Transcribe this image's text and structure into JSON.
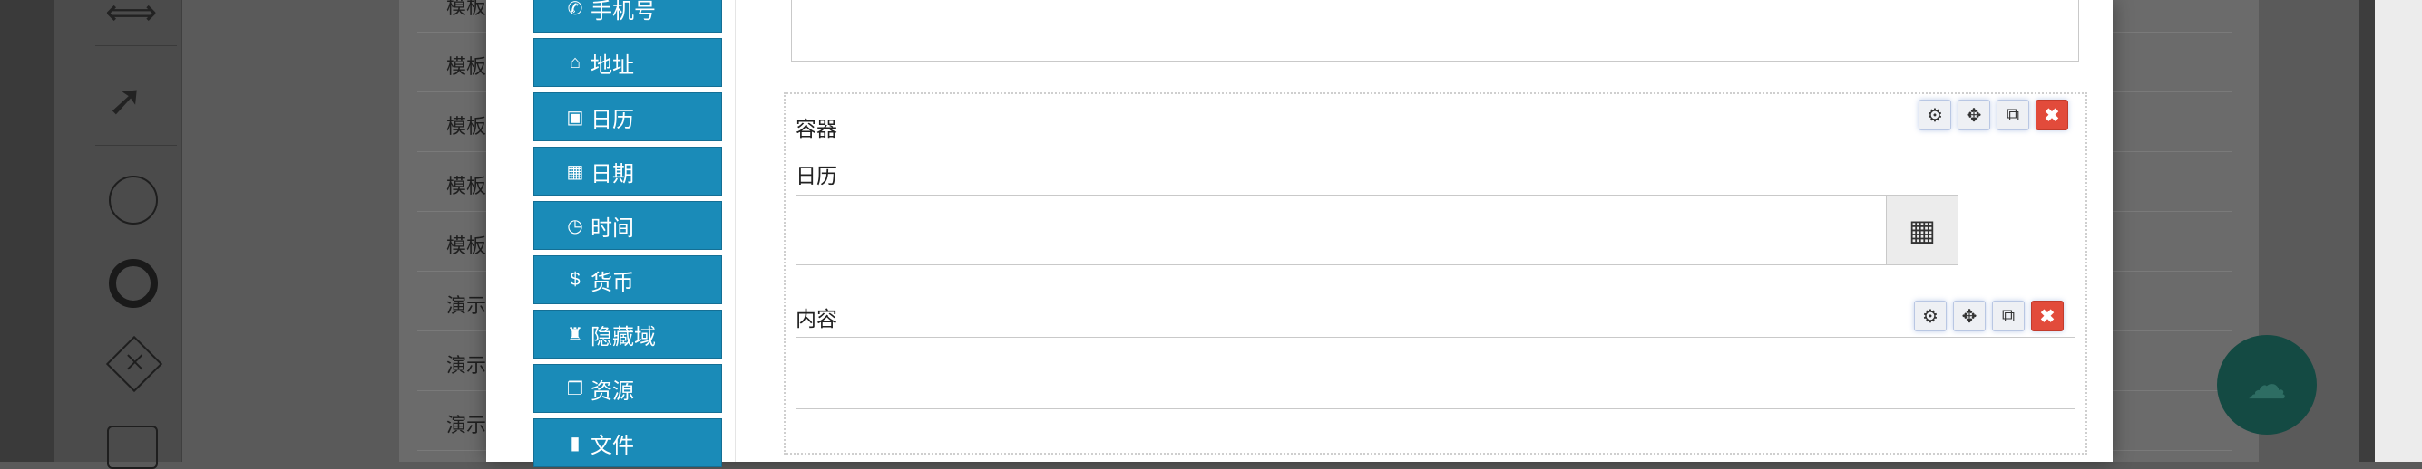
{
  "palette": {
    "icons": [
      "resize-horizontal-icon",
      "connector-arrow-icon",
      "start-event-icon",
      "end-event-icon",
      "gateway-icon",
      "user-task-icon"
    ]
  },
  "list": {
    "rows": [
      "模板",
      "模板",
      "模板",
      "模板",
      "模板",
      "演示",
      "演示",
      "演示"
    ]
  },
  "field_menu": [
    {
      "label": "手机号",
      "icon": "phone-icon",
      "glyph": "✆"
    },
    {
      "label": "地址",
      "icon": "home-icon",
      "glyph": "⌂"
    },
    {
      "label": "日历",
      "icon": "calendar-plus-icon",
      "glyph": "▣"
    },
    {
      "label": "日期",
      "icon": "calendar-icon",
      "glyph": "▦"
    },
    {
      "label": "时间",
      "icon": "clock-icon",
      "glyph": "◷"
    },
    {
      "label": "货币",
      "icon": "dollar-icon",
      "glyph": "$"
    },
    {
      "label": "隐藏域",
      "icon": "user-secret-icon",
      "glyph": "♜"
    },
    {
      "label": "资源",
      "icon": "clone-icon",
      "glyph": "❐"
    },
    {
      "label": "文件",
      "icon": "file-icon",
      "glyph": "▮"
    }
  ],
  "form": {
    "container_label": "容器",
    "date_label": "日历",
    "content_label": "内容",
    "date_value": "",
    "content_value": ""
  },
  "toolbar": {
    "settings_glyph": "⚙",
    "move_glyph": "✥",
    "popout_glyph": "⧉",
    "delete_glyph": "✖"
  },
  "calendar_glyph": "▦",
  "fab_glyph": "☁",
  "colors": {
    "menu_button": "#1a8bb8",
    "delete_button": "#e24b3b",
    "fab": "#144a43"
  }
}
